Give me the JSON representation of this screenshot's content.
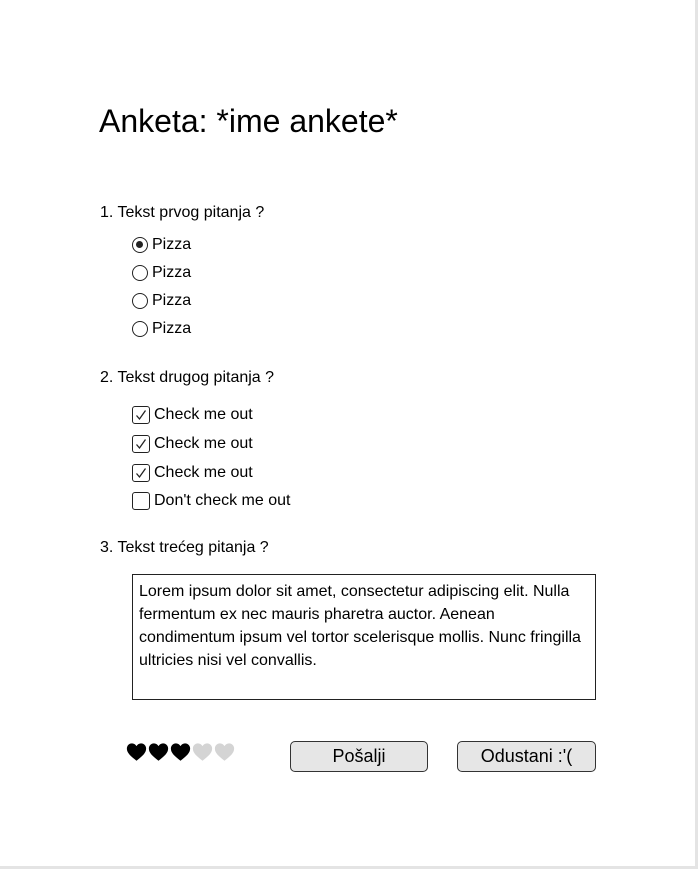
{
  "survey": {
    "title": "Anketa: *ime ankete*"
  },
  "question1": {
    "text": "1. Tekst prvog pitanja ?",
    "options": [
      {
        "label": "Pizza",
        "selected": true
      },
      {
        "label": "Pizza",
        "selected": false
      },
      {
        "label": "Pizza",
        "selected": false
      },
      {
        "label": "Pizza",
        "selected": false
      }
    ]
  },
  "question2": {
    "text": "2. Tekst drugog pitanja ?",
    "options": [
      {
        "label": "Check me out",
        "checked": true
      },
      {
        "label": "Check me out",
        "checked": true
      },
      {
        "label": "Check me out",
        "checked": true
      },
      {
        "label": "Don't check me out",
        "checked": false
      }
    ]
  },
  "question3": {
    "text": "3. Tekst trećeg pitanja ?",
    "answer": "Lorem ipsum dolor sit amet, consectetur adipiscing elit. Nulla fermentum ex nec mauris pharetra auctor. Aenean condimentum ipsum vel tortor scelerisque mollis. Nunc fringilla ultricies nisi vel convallis."
  },
  "rating": {
    "value": 3,
    "max": 5,
    "icon": "heart-icon",
    "filled_color": "#000000",
    "empty_color": "#d4d4d4"
  },
  "actions": {
    "submit_label": "Pošalji",
    "cancel_label": "Odustani :'("
  }
}
